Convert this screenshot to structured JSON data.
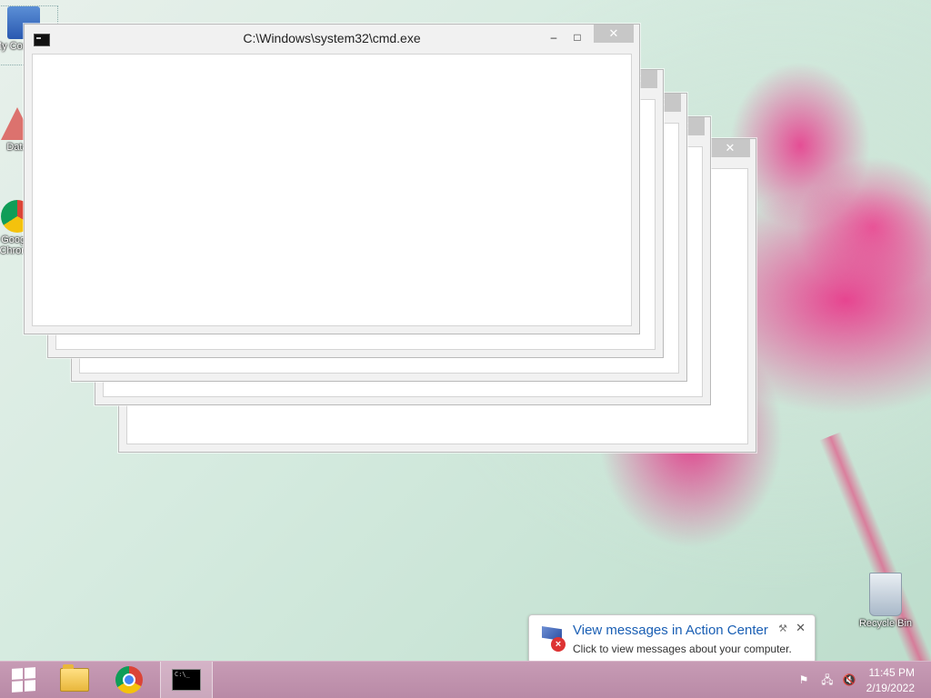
{
  "desktop": {
    "icons": [
      {
        "label": "My Computer"
      },
      {
        "label": "Data"
      },
      {
        "label": "Google Chrome"
      },
      {
        "label": "Recycle Bin"
      }
    ]
  },
  "window": {
    "title": "C:\\Windows\\system32\\cmd.exe",
    "minimize_glyph": "–",
    "maximize_glyph": "□",
    "close_glyph": "✕"
  },
  "notification": {
    "title": "View messages in Action Center",
    "text": "Click to view messages about your computer.",
    "close_glyph": "✕",
    "pin_glyph": "⚒"
  },
  "taskbar": {
    "clock_time": "11:45 PM",
    "clock_date": "2/19/2022"
  }
}
